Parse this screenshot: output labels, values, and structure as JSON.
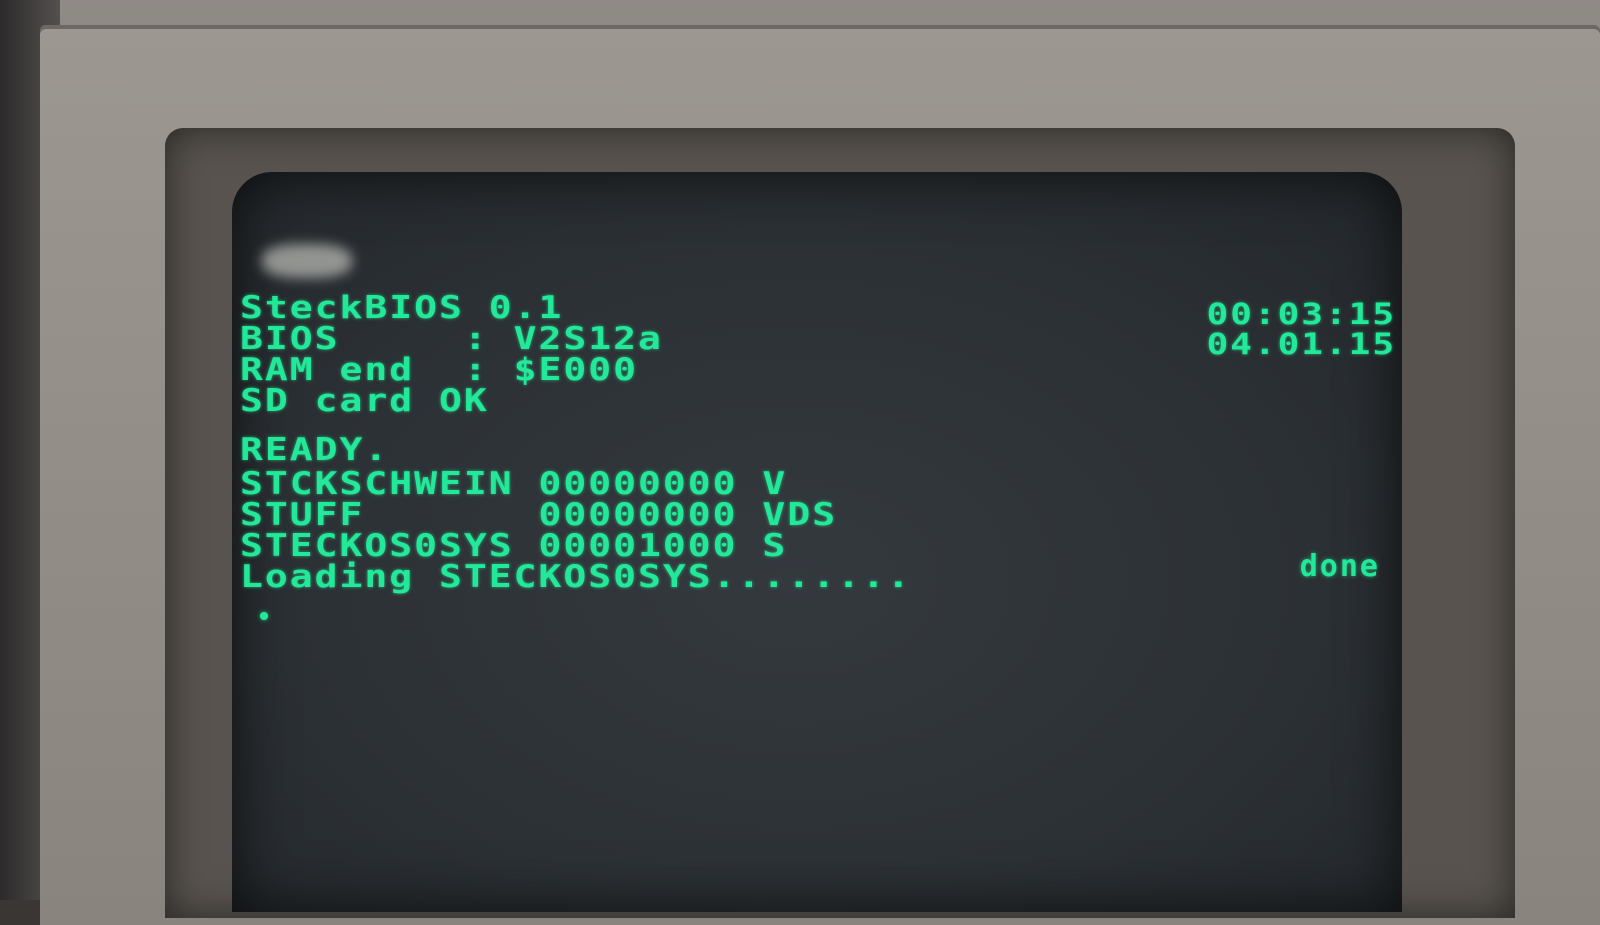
{
  "screen": {
    "lines": [
      "SteckBIOS 0.1",
      "BIOS     : V2S12a",
      "RAM end  : $E000",
      "SD card OK",
      "",
      "READY.",
      "STCKSCHWEIN 00000000 V",
      "STUFF       00000000 VDS",
      "STECKOS0SYS 00001000 S",
      "Loading STECKOS0SYS........"
    ],
    "time": "00:03:15",
    "date": "04.01.15",
    "status": "done"
  },
  "colors": {
    "phosphor": "#22e89a",
    "screen_bg": "#2c3135",
    "bezel": "#8a847e"
  }
}
